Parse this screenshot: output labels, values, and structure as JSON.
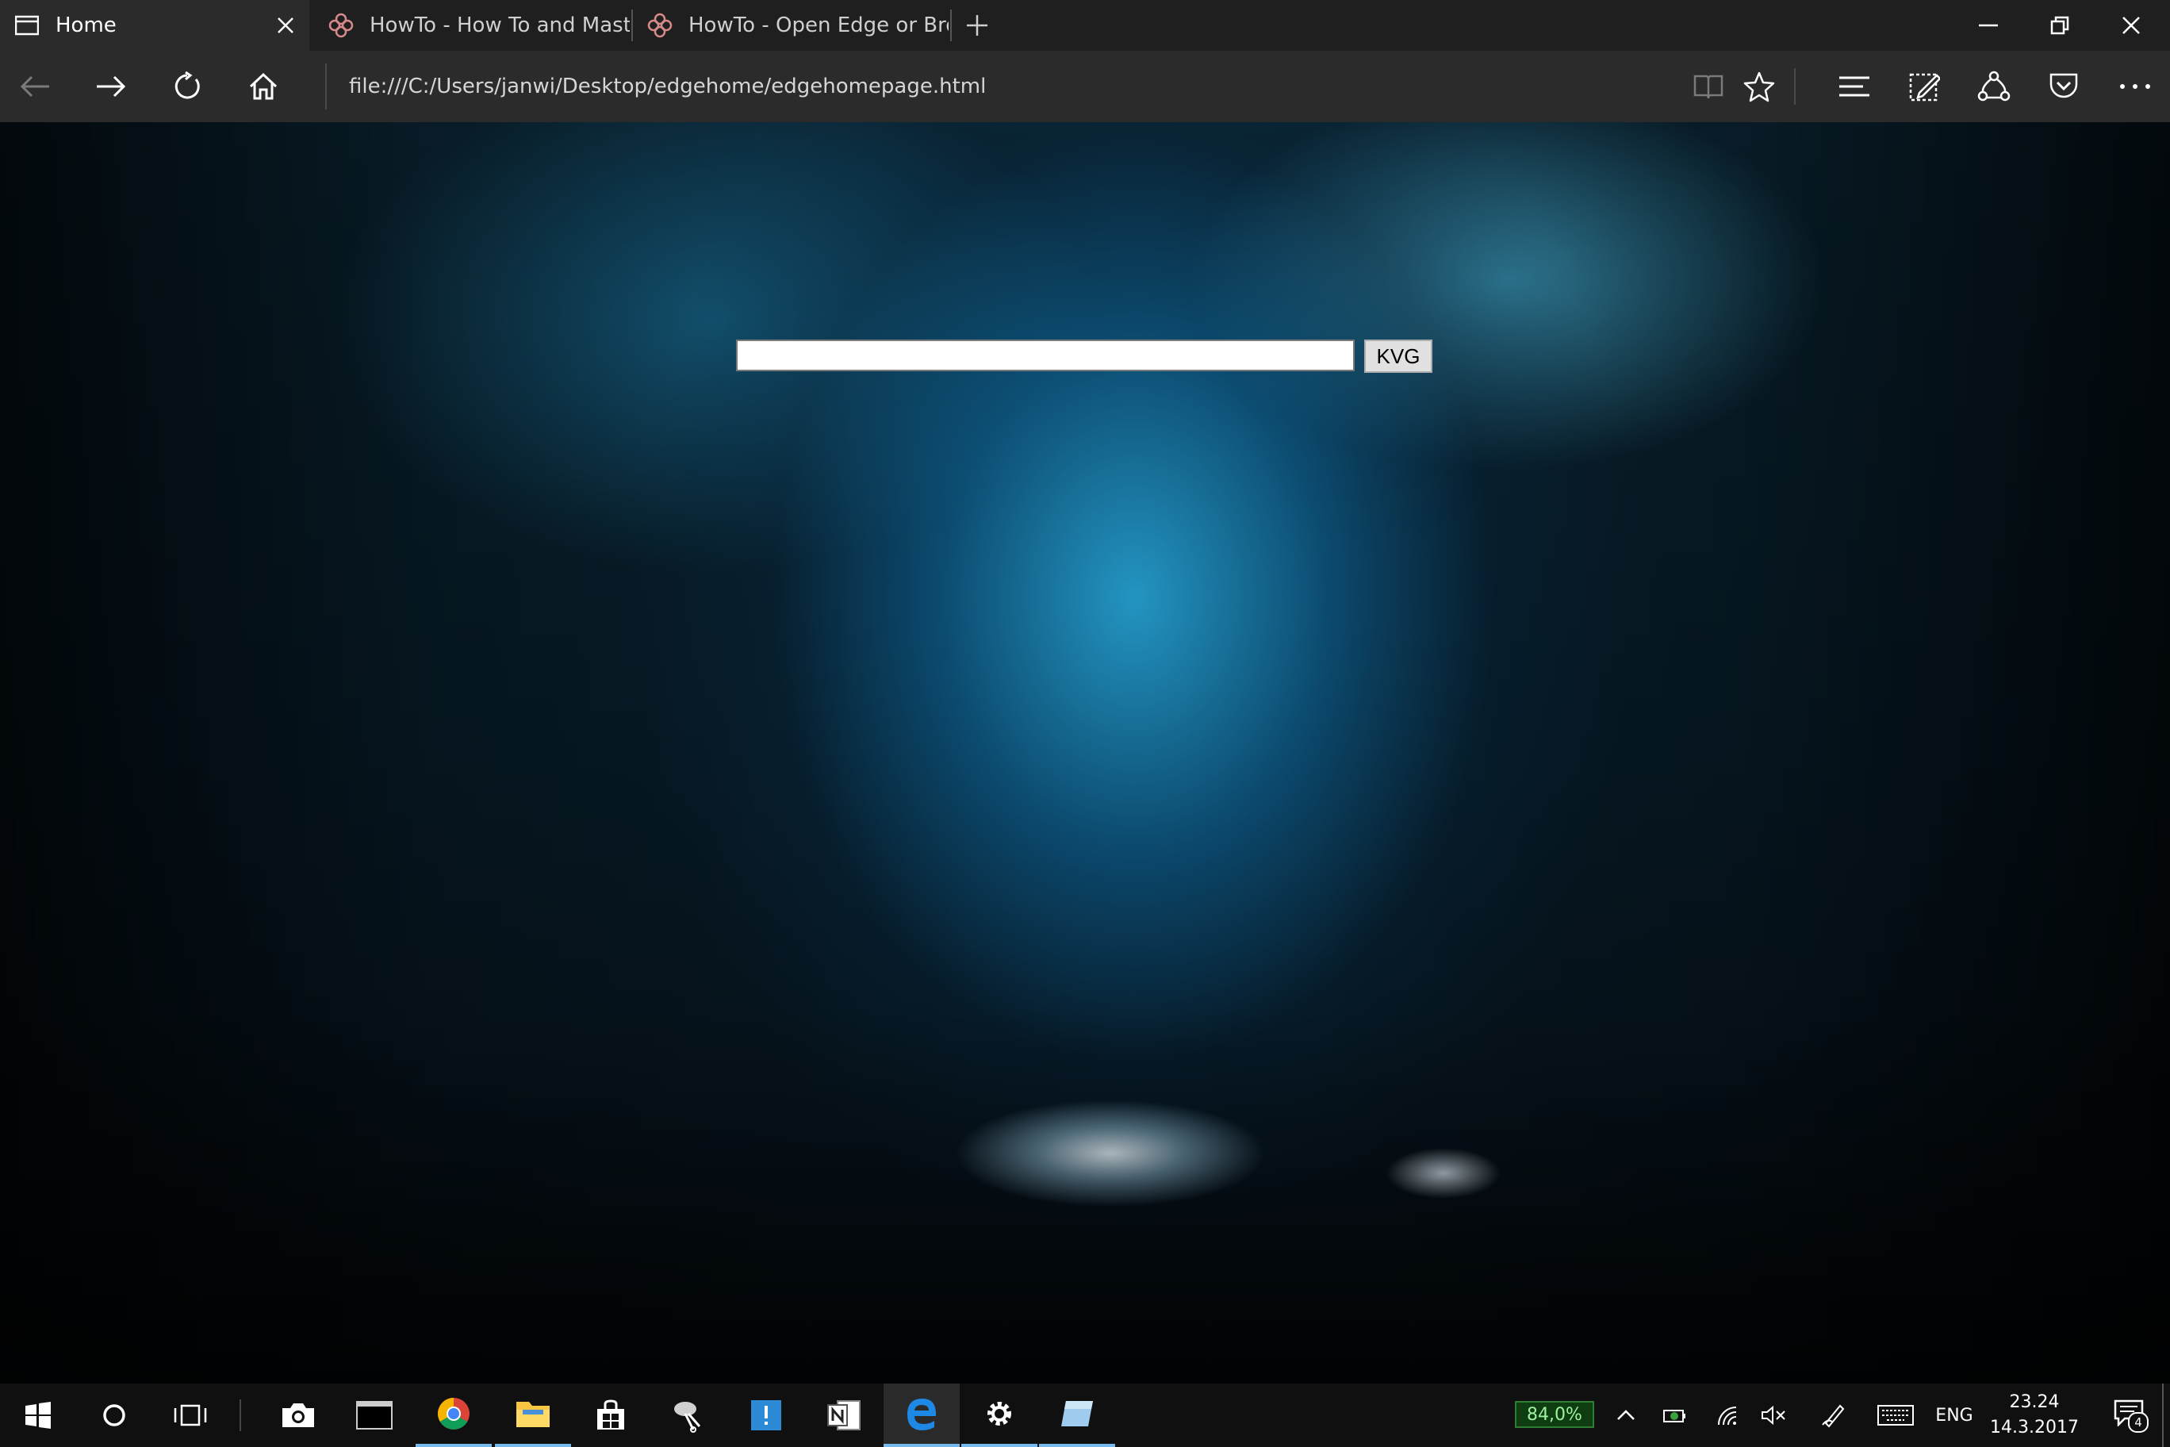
{
  "browser": {
    "tabs": [
      {
        "label": "Home",
        "icon": "page-icon",
        "active": true
      },
      {
        "label": "HowTo - How To and Maste",
        "icon": "howto-icon",
        "active": false
      },
      {
        "label": "HowTo - Open Edge or Brov",
        "icon": "howto-icon",
        "active": false
      }
    ],
    "address": "file:///C:/Users/janwi/Desktop/edgehome/edgehomepage.html"
  },
  "page": {
    "search_placeholder": "",
    "search_button": "KVG"
  },
  "taskbar": {
    "battery": "84,0%",
    "language": "ENG",
    "time": "23.24",
    "date": "14.3.2017",
    "notifications": "4"
  },
  "colors": {
    "taskbar_accent": "#76b9ed",
    "battery_green": "#2e7d32"
  }
}
